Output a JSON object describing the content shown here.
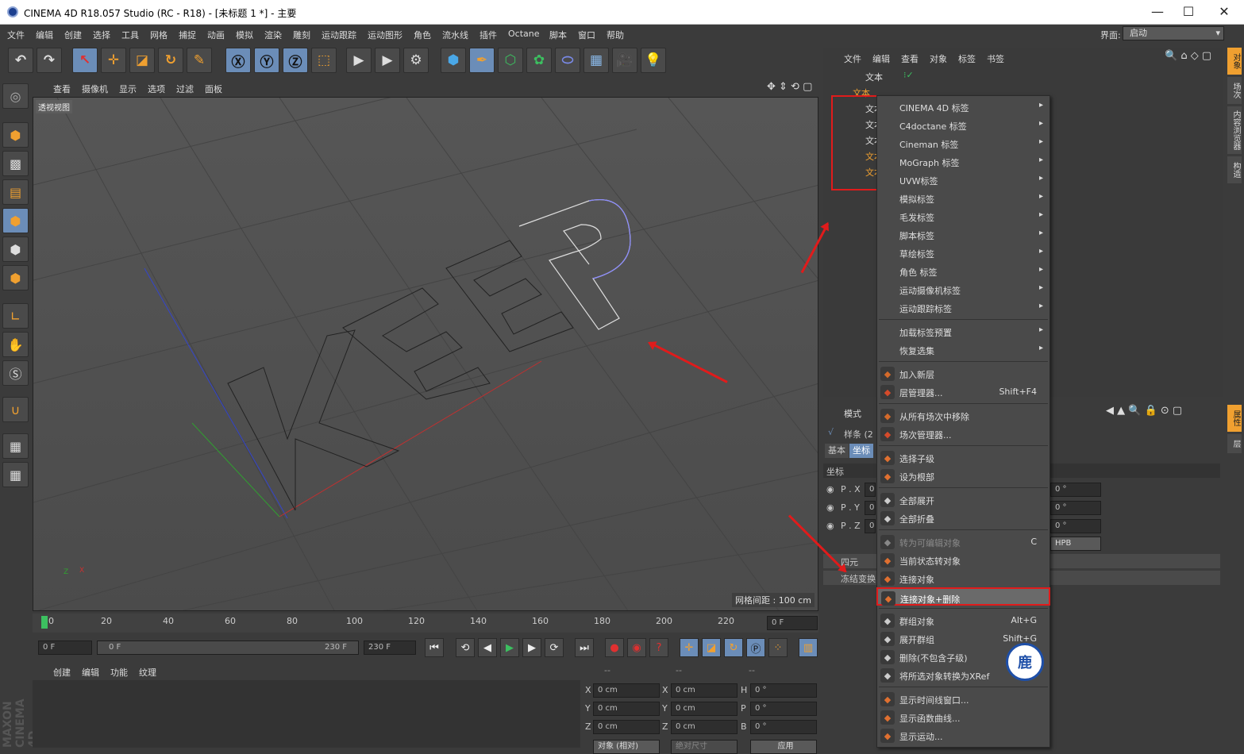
{
  "window": {
    "title": "CINEMA 4D R18.057 Studio (RC - R18) - [未标题 1 *] - 主要"
  },
  "menubar": {
    "items": [
      "文件",
      "编辑",
      "创建",
      "选择",
      "工具",
      "网格",
      "捕捉",
      "动画",
      "模拟",
      "渲染",
      "雕刻",
      "运动跟踪",
      "运动图形",
      "角色",
      "流水线",
      "插件",
      "Octane",
      "脚本",
      "窗口",
      "帮助"
    ],
    "layout_label": "界面:",
    "layout_value": "启动"
  },
  "viewport": {
    "menu": [
      "查看",
      "摄像机",
      "显示",
      "选项",
      "过滤",
      "面板"
    ],
    "label": "透视视图",
    "grid_info": "网格间距 : 100 cm",
    "text_shape": "KEEP"
  },
  "timeline": {
    "ticks": [
      "0",
      "20",
      "40",
      "60",
      "80",
      "100",
      "120",
      "140",
      "160",
      "180",
      "200",
      "220"
    ],
    "current_frame": "0 F"
  },
  "transport": {
    "start": "0 F",
    "range_start": "0 F",
    "range_end": "230 F",
    "end": "230 F"
  },
  "material": {
    "menu": [
      "创建",
      "编辑",
      "功能",
      "纹理"
    ]
  },
  "coords": {
    "headers": [
      "--",
      "--",
      "--"
    ],
    "rows": [
      [
        "X",
        "0 cm",
        "X",
        "0 cm",
        "H",
        "0 °"
      ],
      [
        "Y",
        "0 cm",
        "Y",
        "0 cm",
        "P",
        "0 °"
      ],
      [
        "Z",
        "0 cm",
        "Z",
        "0 cm",
        "B",
        "0 °"
      ]
    ],
    "mode": "对象 (相对)",
    "size_mode": "绝对尺寸",
    "apply": "应用"
  },
  "object_manager": {
    "menu": [
      "文件",
      "编辑",
      "查看",
      "对象",
      "标签",
      "书签"
    ],
    "rows": [
      "文本",
      "文本",
      "文本",
      "文本",
      "文本",
      "文本",
      "文本"
    ]
  },
  "attributes": {
    "menu": [
      "模式"
    ],
    "object": "样条 (2",
    "tabs": [
      "基本",
      "坐标"
    ],
    "section": "坐标",
    "rows": [
      "P . X",
      "P . Y",
      "P . Z"
    ],
    "value": "0",
    "rot_values": [
      "0 °",
      "0 °",
      "0 °"
    ],
    "order": "HPB",
    "quat": "四元",
    "freeze": "冻结变换"
  },
  "right_tabs": [
    "对象",
    "场次",
    "内容浏览器",
    "构造",
    "属性",
    "层"
  ],
  "context_menu": {
    "items": [
      {
        "label": "CINEMA 4D 标签",
        "arrow": "▸",
        "icon": "",
        "color": ""
      },
      {
        "label": "C4doctane 标签",
        "arrow": "▸",
        "icon": "",
        "color": ""
      },
      {
        "label": "Cineman 标签",
        "arrow": "▸",
        "icon": "",
        "color": ""
      },
      {
        "label": "MoGraph 标签",
        "arrow": "▸",
        "icon": "",
        "color": ""
      },
      {
        "label": "UVW标签",
        "arrow": "▸",
        "icon": "",
        "color": ""
      },
      {
        "label": "模拟标签",
        "arrow": "▸",
        "icon": "",
        "color": ""
      },
      {
        "label": "毛发标签",
        "arrow": "▸",
        "icon": "",
        "color": ""
      },
      {
        "label": "脚本标签",
        "arrow": "▸",
        "icon": "",
        "color": ""
      },
      {
        "label": "草绘标签",
        "arrow": "▸",
        "icon": "",
        "color": ""
      },
      {
        "label": "角色 标签",
        "arrow": "▸",
        "icon": "",
        "color": ""
      },
      {
        "label": "运动摄像机标签",
        "arrow": "▸",
        "icon": "",
        "color": ""
      },
      {
        "label": "运动跟踪标签",
        "arrow": "▸",
        "icon": "",
        "color": ""
      },
      {
        "label": "加载标签预置",
        "arrow": "▸",
        "icon": "",
        "color": ""
      },
      {
        "label": "恢复选集",
        "arrow": "▸",
        "icon": "",
        "color": ""
      },
      {
        "label": "加入新层",
        "icon": "layer-add-icon",
        "color": "#d46a2a"
      },
      {
        "label": "层管理器...",
        "shortcut": "Shift+F4",
        "icon": "layer-manager-icon",
        "color": "#d44a2a"
      },
      {
        "label": "从所有场次中移除",
        "icon": "take-remove-icon",
        "color": "#d46a2a"
      },
      {
        "label": "场次管理器...",
        "icon": "take-manager-icon",
        "color": "#d44a2a"
      },
      {
        "label": "选择子级",
        "icon": "select-children-icon",
        "color": "#e07030"
      },
      {
        "label": "设为根部",
        "icon": "set-root-icon",
        "color": "#e07030"
      },
      {
        "label": "全部展开",
        "icon": "expand-all-icon",
        "color": "#cccccc"
      },
      {
        "label": "全部折叠",
        "icon": "collapse-all-icon",
        "color": "#cccccc"
      },
      {
        "label": "转为可编辑对象",
        "shortcut": "C",
        "disabled": true,
        "icon": "make-editable-icon",
        "color": "#888888"
      },
      {
        "label": "当前状态转对象",
        "icon": "current-state-icon",
        "color": "#e07030"
      },
      {
        "label": "连接对象",
        "icon": "connect-icon",
        "color": "#e07030"
      },
      {
        "label": "连接对象+删除",
        "icon": "connect-delete-icon",
        "color": "#e07030",
        "highlight": true
      },
      {
        "label": "群组对象",
        "shortcut": "Alt+G",
        "icon": "group-icon",
        "color": "#cccccc"
      },
      {
        "label": "展开群组",
        "shortcut": "Shift+G",
        "icon": "ungroup-icon",
        "color": "#cccccc"
      },
      {
        "label": "删除(不包含子级)",
        "icon": "delete-icon",
        "color": "#cccccc"
      },
      {
        "label": "将所选对象转换为XRef",
        "icon": "xref-icon",
        "color": "#cccccc"
      },
      {
        "label": "显示时间线窗口...",
        "icon": "timeline-icon",
        "color": "#e07030"
      },
      {
        "label": "显示函数曲线...",
        "icon": "fcurve-icon",
        "color": "#e07030"
      },
      {
        "label": "显示运动...",
        "icon": "motion-icon",
        "color": "#e07030"
      }
    ]
  },
  "badge": {
    "text": "鹿"
  },
  "colors": {
    "highlight_box": "#e01b1b",
    "bg": "#3b3b3b",
    "viewport": "#505050",
    "accent": "#f0a030"
  }
}
